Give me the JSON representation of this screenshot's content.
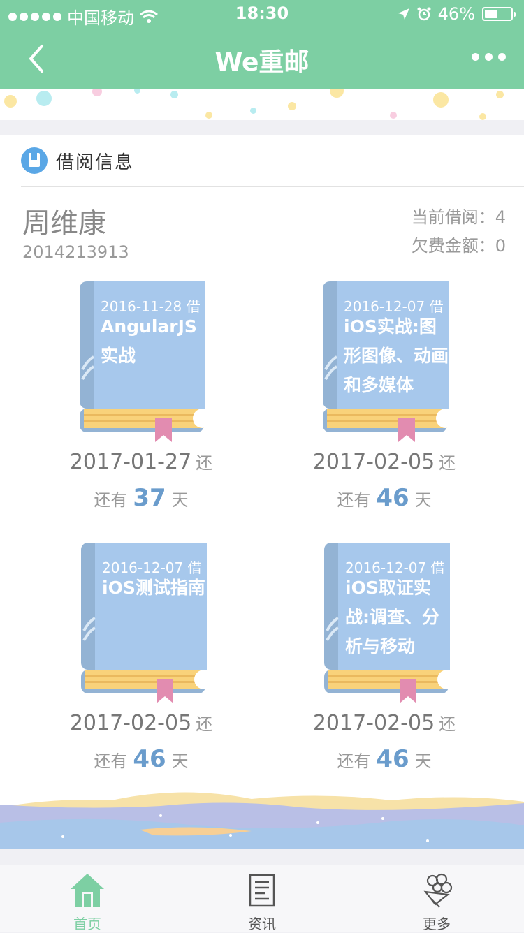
{
  "status": {
    "carrier": "中国移动",
    "time": "18:30",
    "battery": "46%"
  },
  "nav": {
    "title": "We重邮"
  },
  "section": {
    "title": "借阅信息"
  },
  "user": {
    "name": "周维康",
    "id": "2014213913",
    "current_label": "当前借阅：4",
    "fee_label": "欠费金额：0"
  },
  "books": [
    {
      "borrow": "2016-11-28 借",
      "title": "AngularJS实战",
      "due": "2017-01-27",
      "due_suffix": "还",
      "remain_prefix": "还有",
      "remain_days": "37",
      "remain_suffix": "天"
    },
    {
      "borrow": "2016-12-07 借",
      "title": "iOS实战:图形图像、动画和多媒体",
      "due": "2017-02-05",
      "due_suffix": "还",
      "remain_prefix": "还有",
      "remain_days": "46",
      "remain_suffix": "天"
    },
    {
      "borrow": "2016-12-07 借",
      "title": "iOS测试指南",
      "due": "2017-02-05",
      "due_suffix": "还",
      "remain_prefix": "还有",
      "remain_days": "46",
      "remain_suffix": "天"
    },
    {
      "borrow": "2016-12-07 借",
      "title": "iOS取证实战:调查、分析与移动",
      "due": "2017-02-05",
      "due_suffix": "还",
      "remain_prefix": "还有",
      "remain_days": "46",
      "remain_suffix": "天"
    }
  ],
  "tabs": [
    {
      "label": "首页",
      "active": true
    },
    {
      "label": "资讯"
    },
    {
      "label": "更多"
    }
  ],
  "colors": {
    "brand": "#7dcfa3",
    "book_cover": "#a7c8ec",
    "book_spine": "#93b3d4",
    "pages": "#f9d27a",
    "ribbon": "#e28cb0",
    "days": "#6a9ccc"
  }
}
